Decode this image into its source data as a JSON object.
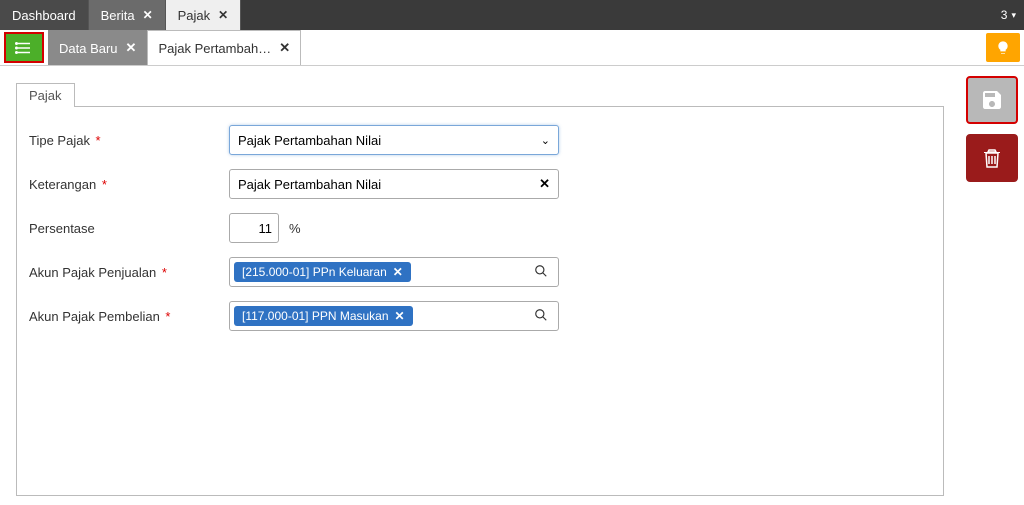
{
  "topTabs": {
    "dashboard": "Dashboard",
    "berita": "Berita",
    "pajak": "Pajak"
  },
  "topCount": "3",
  "subTabs": {
    "dataBaru": "Data Baru",
    "pajakDetail": "Pajak Pertambah…"
  },
  "panel": {
    "tab": "Pajak"
  },
  "form": {
    "tipePajak": {
      "label": "Tipe Pajak",
      "value": "Pajak Pertambahan Nilai"
    },
    "keterangan": {
      "label": "Keterangan",
      "value": "Pajak Pertambahan Nilai"
    },
    "persentase": {
      "label": "Persentase",
      "value": "11",
      "unit": "%"
    },
    "akunPenjualan": {
      "label": "Akun Pajak Penjualan",
      "chip": "[215.000-01] PPn Keluaran"
    },
    "akunPembelian": {
      "label": "Akun Pajak Pembelian",
      "chip": "[117.000-01] PPN Masukan"
    }
  }
}
